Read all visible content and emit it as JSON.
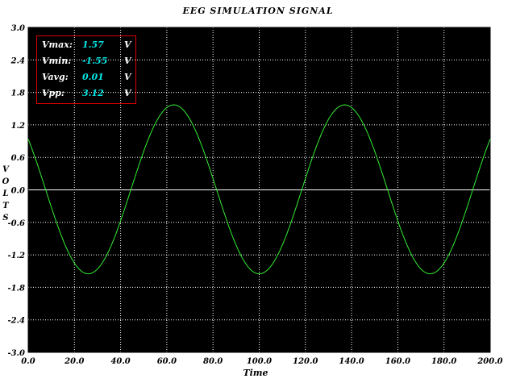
{
  "window": {
    "title": "EEG SIMULATION SIGNAL"
  },
  "axes": {
    "ylabel_letters": [
      "V",
      "O",
      "L",
      "T",
      "S"
    ],
    "xlabel": "Time",
    "y_ticks": [
      "3.0",
      "2.4",
      "1.8",
      "1.2",
      "0.6",
      "0.0",
      "-0.6",
      "-1.2",
      "-1.8",
      "-2.4",
      "-3.0"
    ],
    "x_ticks": [
      "0.0",
      "20.0",
      "40.0",
      "60.0",
      "80.0",
      "100.0",
      "120.0",
      "140.0",
      "160.0",
      "180.0",
      "200.0"
    ]
  },
  "readout": {
    "rows": [
      {
        "name": "Vmax:",
        "value": "1.57",
        "unit": "V"
      },
      {
        "name": "Vmin:",
        "value": "-1.55",
        "unit": "V"
      },
      {
        "name": "Vavg:",
        "value": "0.01",
        "unit": "V"
      },
      {
        "name": "Vpp:",
        "value": "3.12",
        "unit": "V"
      }
    ]
  },
  "colors": {
    "plot_background": "#000000",
    "grid": "#ffffff",
    "zero_line": "#ffffff",
    "trace": "#33ee33",
    "readout_border": "#e00000",
    "readout_value": "#00e8e8"
  },
  "chart_data": {
    "type": "line",
    "title": "EEG SIMULATION SIGNAL",
    "xlabel": "Time",
    "ylabel": "VOLTS",
    "xlim": [
      0,
      200
    ],
    "ylim": [
      -3.0,
      3.0
    ],
    "grid": true,
    "signal": {
      "shape": "sine",
      "amplitude": 1.56,
      "period": 74,
      "phase_peak_at": 63,
      "offset": 0.01
    },
    "x": [
      0,
      5,
      10,
      15,
      20,
      25,
      30,
      35,
      40,
      45,
      50,
      55,
      60,
      63,
      65,
      70,
      75,
      80,
      85,
      90,
      95,
      100,
      105,
      110,
      115,
      120,
      125,
      130,
      137,
      140,
      145,
      150,
      155,
      160,
      165,
      170,
      175,
      180,
      185,
      190,
      195,
      200
    ],
    "y": [
      1.1,
      0.55,
      -0.05,
      -0.65,
      -1.12,
      -1.47,
      -1.55,
      -1.35,
      -0.93,
      -0.38,
      0.22,
      0.85,
      1.35,
      1.57,
      1.52,
      1.2,
      0.7,
      0.12,
      -0.48,
      -1.02,
      -1.4,
      -1.55,
      -1.4,
      -1.02,
      -0.48,
      0.12,
      0.7,
      1.2,
      1.57,
      1.5,
      1.2,
      0.72,
      0.12,
      -0.48,
      -1.02,
      -1.4,
      -1.55,
      -1.4,
      -1.0,
      -0.45,
      0.2,
      1.05
    ]
  }
}
